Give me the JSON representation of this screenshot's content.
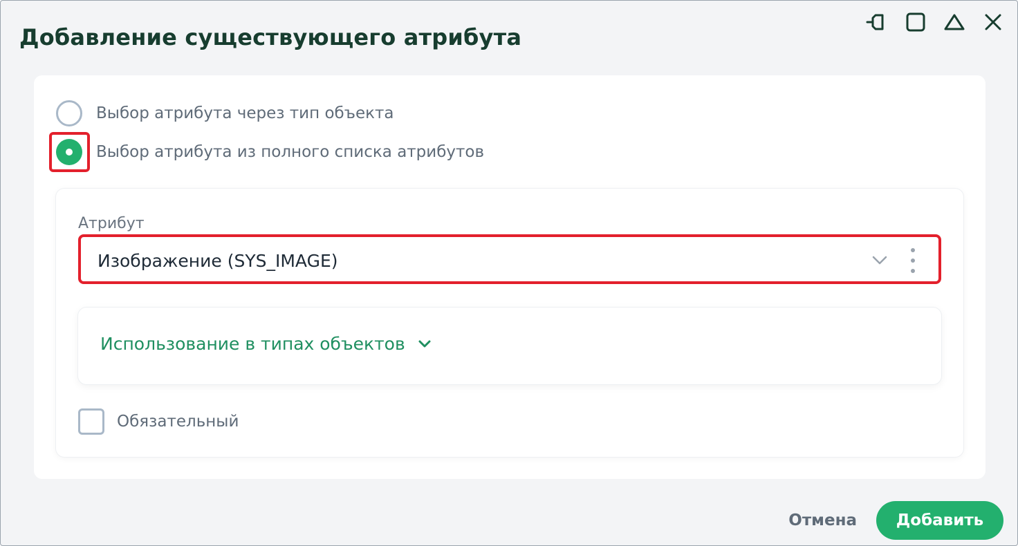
{
  "dialog": {
    "title": "Добавление существующего атрибута",
    "window_controls": [
      {
        "name": "pin-icon"
      },
      {
        "name": "maximize-icon"
      },
      {
        "name": "collapse-icon"
      },
      {
        "name": "close-icon"
      }
    ]
  },
  "selection_mode": {
    "options": [
      {
        "label": "Выбор атрибута через тип объекта",
        "checked": false
      },
      {
        "label": "Выбор атрибута из полного списка атрибутов",
        "checked": true
      }
    ]
  },
  "attribute_field": {
    "label": "Атрибут",
    "value": "Изображение (SYS_IMAGE)"
  },
  "usage": {
    "label": "Использование в типах объектов"
  },
  "required": {
    "label": "Обязательный",
    "checked": false
  },
  "footer": {
    "cancel_label": "Отмена",
    "add_label": "Добавить"
  },
  "colors": {
    "accent": "#23b06e",
    "title": "#173d2f",
    "highlight": "#e3202c",
    "link": "#1f8f60"
  }
}
